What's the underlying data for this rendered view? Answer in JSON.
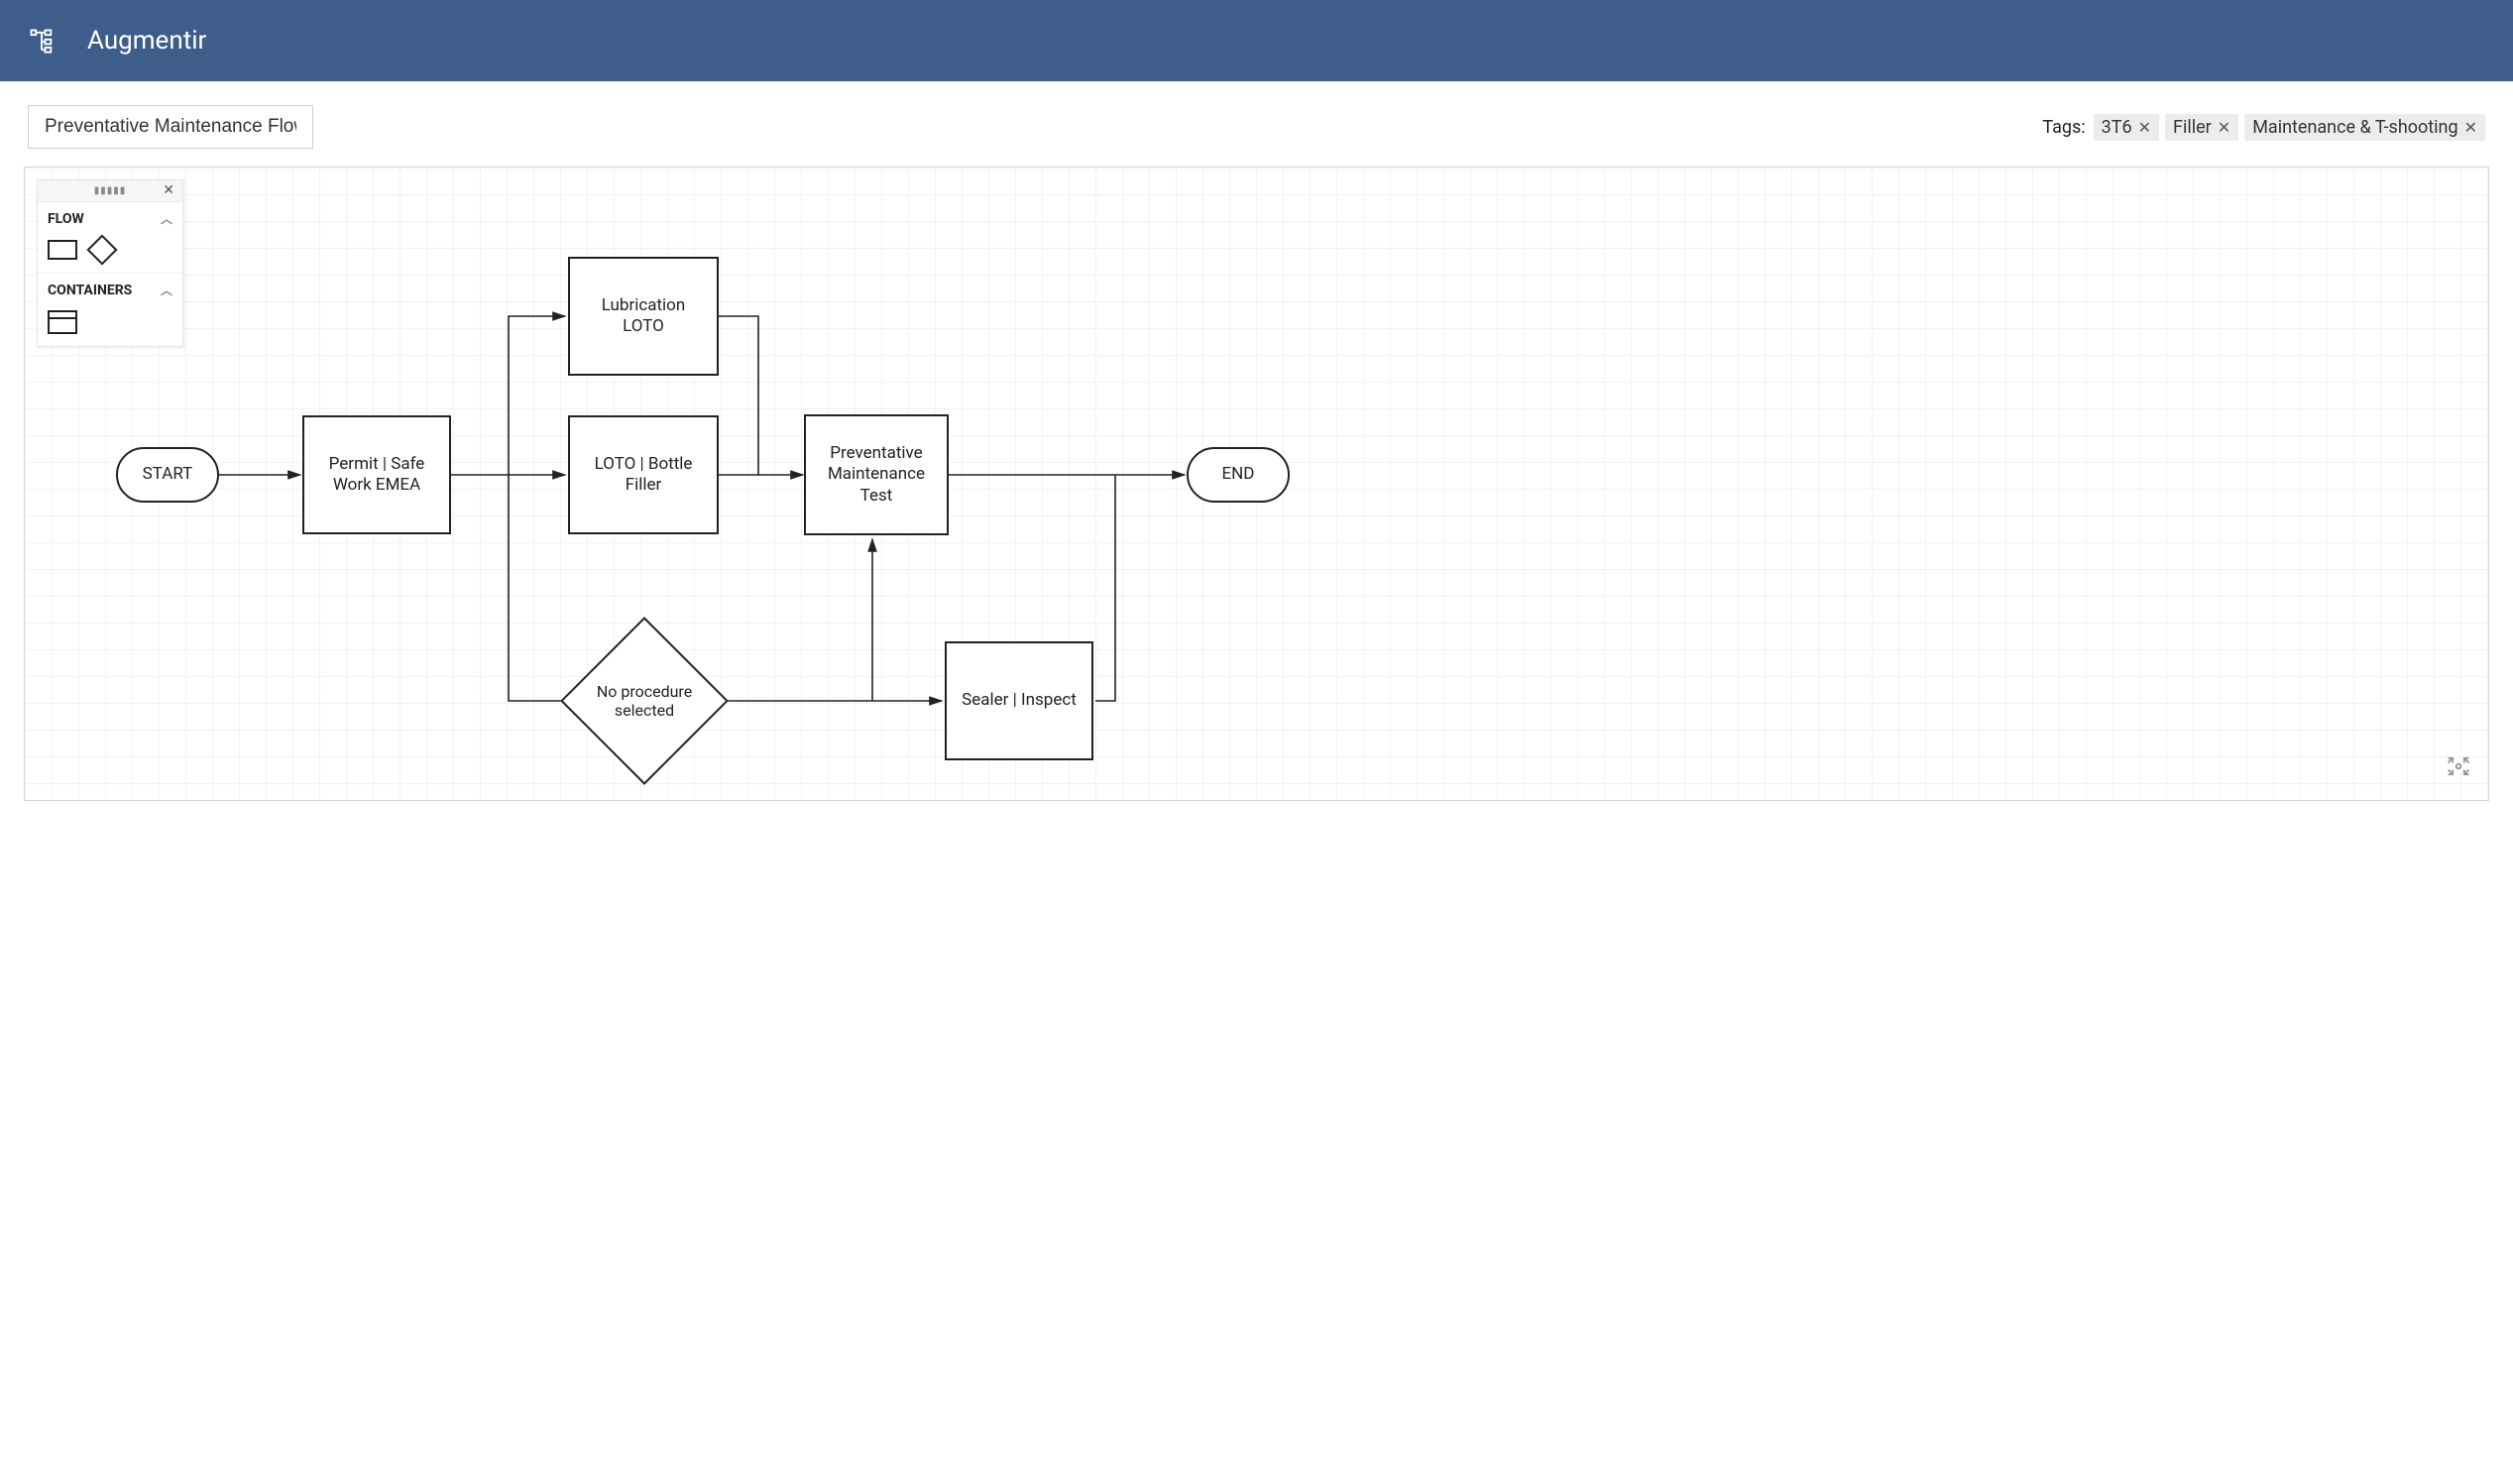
{
  "header": {
    "app_name": "Augmentir"
  },
  "toolbar": {
    "title": "Preventative Maintenance Flow",
    "tags_label": "Tags:",
    "tags": [
      "3T6",
      "Filler",
      "Maintenance & T-shooting"
    ]
  },
  "palette": {
    "section_flow": "FLOW",
    "section_containers": "CONTAINERS"
  },
  "nodes": {
    "start": "START",
    "end": "END",
    "permit": "Permit | Safe Work EMEA",
    "lubrication": "Lubrication LOTO",
    "loto_filler": "LOTO | Bottle Filler",
    "pm_test": "Preventative Maintenance Test",
    "sealer": "Sealer | Inspect",
    "no_proc": "No procedure selected"
  }
}
